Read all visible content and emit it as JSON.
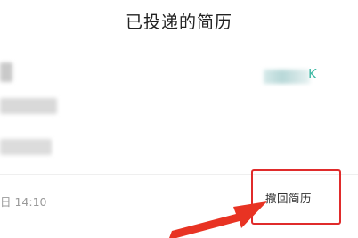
{
  "header": {
    "title": "已投递的简历"
  },
  "record": {
    "status_suffix": "K",
    "date": "日 14:10",
    "withdraw_label": "撤回简历"
  },
  "colors": {
    "accent": "#40b9a5",
    "highlight": "#e02b2b"
  }
}
